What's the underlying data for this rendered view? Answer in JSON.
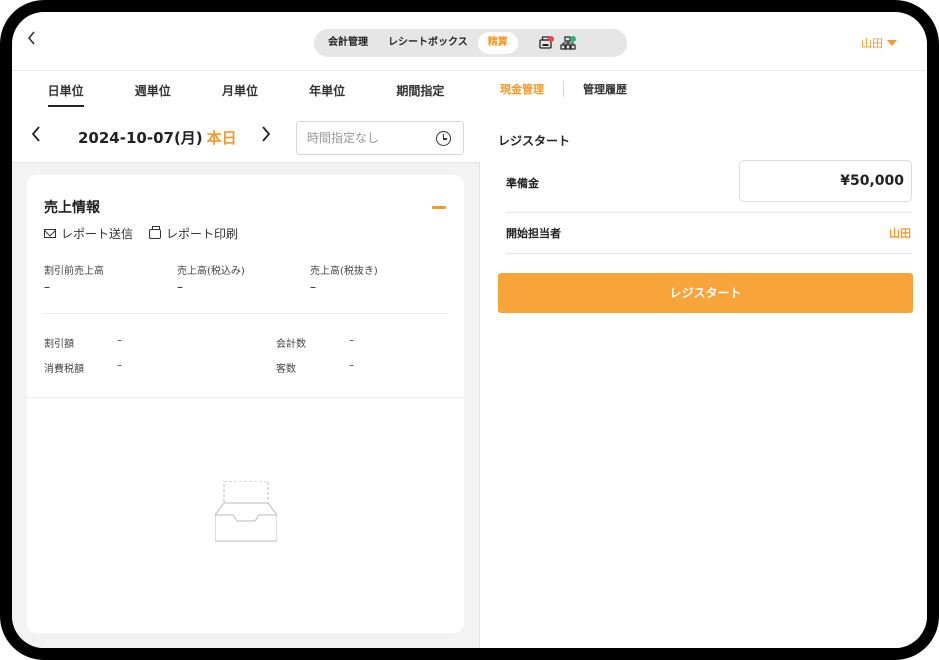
{
  "header": {
    "back_icon": "chevron-left-icon",
    "tabs": [
      {
        "label": "会計管理",
        "active": false
      },
      {
        "label": "レシートボックス",
        "active": false
      },
      {
        "label": "精算",
        "active": true
      }
    ],
    "status_icons": [
      "printer-error-icon",
      "network-ok-icon"
    ],
    "user": "山田",
    "accent_color": "#f39a2a"
  },
  "left": {
    "period_tabs": [
      {
        "label": "日単位",
        "active": true
      },
      {
        "label": "週単位",
        "active": false
      },
      {
        "label": "月単位",
        "active": false
      },
      {
        "label": "年単位",
        "active": false
      },
      {
        "label": "期間指定",
        "active": false
      }
    ],
    "date": "2024-10-07(月)",
    "today_label": "本日",
    "time_placeholder": "時間指定なし",
    "card": {
      "title": "売上情報",
      "send_report": "レポート送信",
      "print_report": "レポート印刷",
      "metrics": [
        {
          "label": "割引前売上高",
          "value": "–"
        },
        {
          "label": "売上高(税込み)",
          "value": "–"
        },
        {
          "label": "売上高(税抜き)",
          "value": "–"
        }
      ],
      "rows": [
        {
          "label": "割引額",
          "value": "–"
        },
        {
          "label": "会計数",
          "value": "–"
        },
        {
          "label": "消費税額",
          "value": "–"
        },
        {
          "label": "客数",
          "value": "–"
        }
      ]
    }
  },
  "right": {
    "tabs": [
      {
        "label": "現金管理",
        "active": true
      },
      {
        "label": "管理履歴",
        "active": false
      }
    ],
    "section_title": "レジスタート",
    "cash_label": "準備金",
    "cash_value": "¥50,000",
    "staff_label": "開始担当者",
    "staff_value": "山田",
    "start_button": "レジスタート"
  }
}
